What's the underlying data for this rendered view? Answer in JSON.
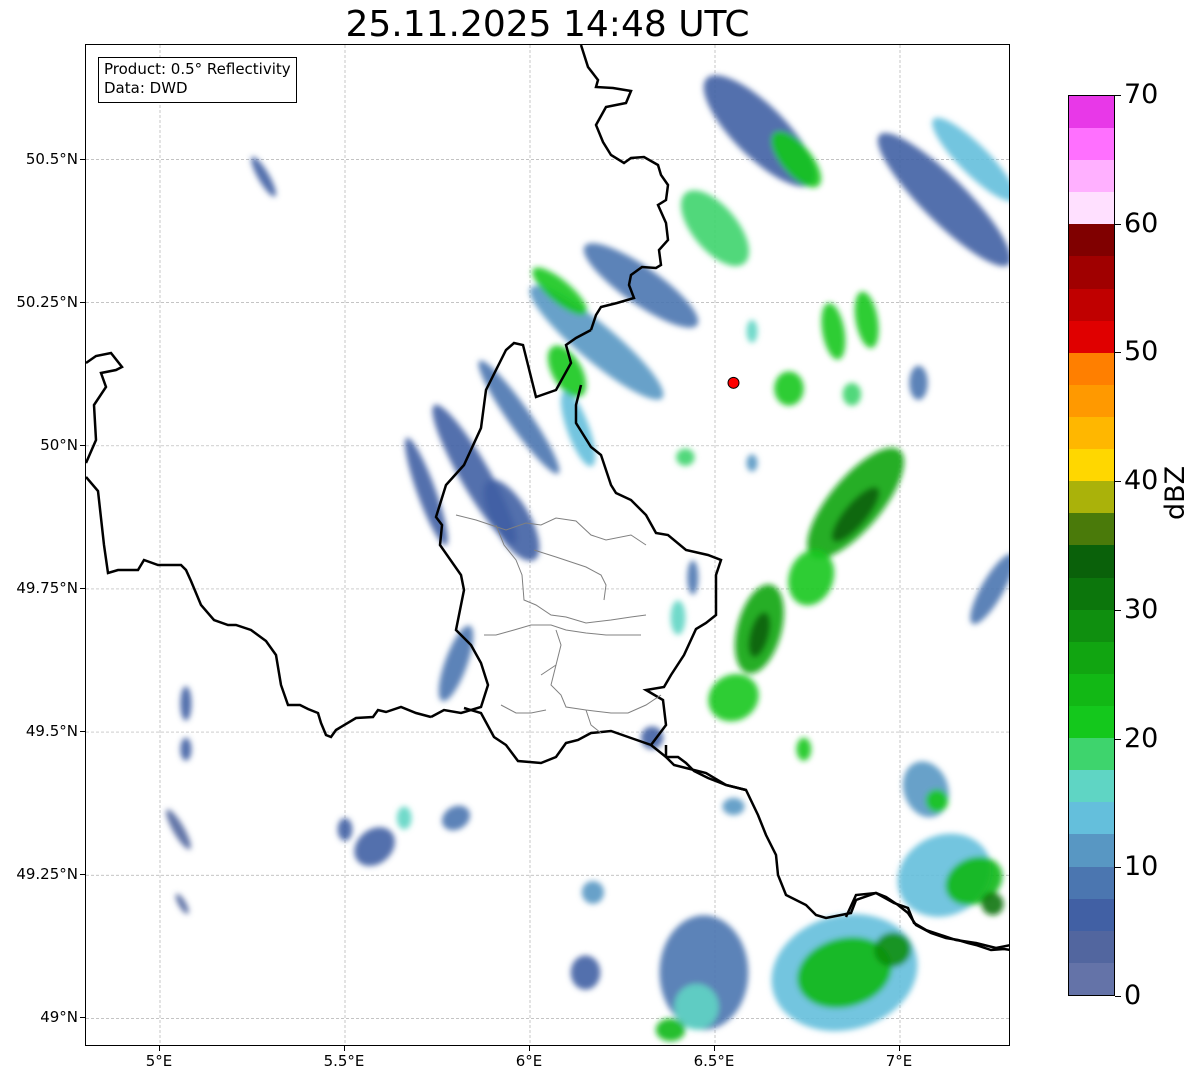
{
  "title": "25.11.2025 14:48 UTC",
  "info_box": {
    "product": "Product: 0.5° Reflectivity",
    "data": "Data: DWD"
  },
  "map": {
    "extent": {
      "lon_min": 4.8,
      "lon_max": 7.3,
      "lat_min": 48.95,
      "lat_max": 50.7
    },
    "lat_ticks": [
      {
        "value": 50.5,
        "label": "50.5°N"
      },
      {
        "value": 50.25,
        "label": "50.25°N"
      },
      {
        "value": 50.0,
        "label": "50°N"
      },
      {
        "value": 49.75,
        "label": "49.75°N"
      },
      {
        "value": 49.5,
        "label": "49.5°N"
      },
      {
        "value": 49.25,
        "label": "49.25°N"
      },
      {
        "value": 49.0,
        "label": "49°N"
      }
    ],
    "lon_ticks": [
      {
        "value": 5.0,
        "label": "5°E"
      },
      {
        "value": 5.5,
        "label": "5.5°E"
      },
      {
        "value": 6.0,
        "label": "6°E"
      },
      {
        "value": 6.5,
        "label": "6.5°E"
      },
      {
        "value": 7.0,
        "label": "7°E"
      }
    ],
    "radar_site": {
      "lon": 6.55,
      "lat": 50.11,
      "color": "#ff0000"
    },
    "border_color": "#000000",
    "admin_border_color": "#808080",
    "grid": true
  },
  "colorbar": {
    "label": "dBZ",
    "min": 0,
    "max": 70,
    "step": 2.5,
    "ticks": [
      {
        "value": 0,
        "label": "0"
      },
      {
        "value": 10,
        "label": "10"
      },
      {
        "value": 20,
        "label": "20"
      },
      {
        "value": 30,
        "label": "30"
      },
      {
        "value": 40,
        "label": "40"
      },
      {
        "value": 50,
        "label": "50"
      },
      {
        "value": 60,
        "label": "60"
      },
      {
        "value": 70,
        "label": "70"
      }
    ],
    "colors": [
      "#6473a8",
      "#52669f",
      "#4160a4",
      "#4b76b0",
      "#5897c3",
      "#64bfdc",
      "#5fd5c4",
      "#3ed46d",
      "#14c81c",
      "#12b815",
      "#11a511",
      "#0f8f0f",
      "#0c760c",
      "#0a610a",
      "#4a7a0a",
      "#aab20a",
      "#ffd700",
      "#ffb700",
      "#ff9900",
      "#ff7f00",
      "#e00000",
      "#c00000",
      "#a00000",
      "#800000",
      "#ffe0ff",
      "#ffb0ff",
      "#ff70ff",
      "#e838e8"
    ]
  },
  "echoes": [
    {
      "lon": 6.62,
      "lat": 50.55,
      "rx": 0.07,
      "ry": 0.13,
      "rot": -45,
      "dbz": 6
    },
    {
      "lon": 6.5,
      "lat": 50.38,
      "rx": 0.06,
      "ry": 0.08,
      "rot": -40,
      "dbz": 18
    },
    {
      "lon": 6.72,
      "lat": 50.5,
      "rx": 0.04,
      "ry": 0.06,
      "rot": -40,
      "dbz": 22
    },
    {
      "lon": 6.3,
      "lat": 50.28,
      "rx": 0.05,
      "ry": 0.12,
      "rot": -55,
      "dbz": 8
    },
    {
      "lon": 6.18,
      "lat": 50.18,
      "rx": 0.05,
      "ry": 0.15,
      "rot": -50,
      "dbz": 10
    },
    {
      "lon": 6.08,
      "lat": 50.27,
      "rx": 0.03,
      "ry": 0.06,
      "rot": -50,
      "dbz": 20
    },
    {
      "lon": 5.97,
      "lat": 50.05,
      "rx": 0.03,
      "ry": 0.12,
      "rot": -35,
      "dbz": 8
    },
    {
      "lon": 5.85,
      "lat": 49.95,
      "rx": 0.04,
      "ry": 0.14,
      "rot": -30,
      "dbz": 6
    },
    {
      "lon": 5.72,
      "lat": 49.92,
      "rx": 0.025,
      "ry": 0.1,
      "rot": -20,
      "dbz": 5
    },
    {
      "lon": 5.95,
      "lat": 49.87,
      "rx": 0.05,
      "ry": 0.08,
      "rot": -30,
      "dbz": 5
    },
    {
      "lon": 6.13,
      "lat": 50.03,
      "rx": 0.03,
      "ry": 0.07,
      "rot": -20,
      "dbz": 14
    },
    {
      "lon": 6.1,
      "lat": 50.13,
      "rx": 0.04,
      "ry": 0.05,
      "rot": -30,
      "dbz": 20
    },
    {
      "lon": 5.28,
      "lat": 50.47,
      "rx": 0.015,
      "ry": 0.04,
      "rot": -30,
      "dbz": 5
    },
    {
      "lon": 7.12,
      "lat": 50.43,
      "rx": 0.06,
      "ry": 0.16,
      "rot": -45,
      "dbz": 7
    },
    {
      "lon": 7.2,
      "lat": 50.5,
      "rx": 0.04,
      "ry": 0.1,
      "rot": -45,
      "dbz": 14
    },
    {
      "lon": 6.82,
      "lat": 50.2,
      "rx": 0.03,
      "ry": 0.05,
      "rot": -10,
      "dbz": 22
    },
    {
      "lon": 6.91,
      "lat": 50.22,
      "rx": 0.03,
      "ry": 0.05,
      "rot": -10,
      "dbz": 20
    },
    {
      "lon": 6.7,
      "lat": 50.1,
      "rx": 0.04,
      "ry": 0.03,
      "rot": 0,
      "dbz": 20
    },
    {
      "lon": 6.87,
      "lat": 50.09,
      "rx": 0.025,
      "ry": 0.02,
      "rot": 0,
      "dbz": 18
    },
    {
      "lon": 6.6,
      "lat": 50.2,
      "rx": 0.015,
      "ry": 0.02,
      "rot": 0,
      "dbz": 15
    },
    {
      "lon": 7.05,
      "lat": 50.11,
      "rx": 0.025,
      "ry": 0.03,
      "rot": 0,
      "dbz": 8
    },
    {
      "lon": 6.42,
      "lat": 49.98,
      "rx": 0.025,
      "ry": 0.015,
      "rot": 0,
      "dbz": 18
    },
    {
      "lon": 6.6,
      "lat": 49.97,
      "rx": 0.015,
      "ry": 0.015,
      "rot": 0,
      "dbz": 10
    },
    {
      "lon": 6.88,
      "lat": 49.9,
      "rx": 0.07,
      "ry": 0.12,
      "rot": 40,
      "dbz": 26
    },
    {
      "lon": 6.88,
      "lat": 49.88,
      "rx": 0.03,
      "ry": 0.06,
      "rot": 40,
      "dbz": 34
    },
    {
      "lon": 6.76,
      "lat": 49.77,
      "rx": 0.06,
      "ry": 0.05,
      "rot": 20,
      "dbz": 22
    },
    {
      "lon": 6.62,
      "lat": 49.68,
      "rx": 0.06,
      "ry": 0.08,
      "rot": 15,
      "dbz": 26
    },
    {
      "lon": 6.62,
      "lat": 49.67,
      "rx": 0.025,
      "ry": 0.04,
      "rot": 15,
      "dbz": 34
    },
    {
      "lon": 6.55,
      "lat": 49.56,
      "rx": 0.07,
      "ry": 0.04,
      "rot": -30,
      "dbz": 22
    },
    {
      "lon": 6.4,
      "lat": 49.7,
      "rx": 0.02,
      "ry": 0.03,
      "rot": 0,
      "dbz": 16
    },
    {
      "lon": 6.44,
      "lat": 49.77,
      "rx": 0.015,
      "ry": 0.03,
      "rot": 0,
      "dbz": 8
    },
    {
      "lon": 6.74,
      "lat": 49.47,
      "rx": 0.02,
      "ry": 0.02,
      "rot": 0,
      "dbz": 22
    },
    {
      "lon": 7.25,
      "lat": 49.75,
      "rx": 0.03,
      "ry": 0.07,
      "rot": 30,
      "dbz": 8
    },
    {
      "lon": 6.33,
      "lat": 49.49,
      "rx": 0.03,
      "ry": 0.02,
      "rot": 0,
      "dbz": 6
    },
    {
      "lon": 5.8,
      "lat": 49.62,
      "rx": 0.03,
      "ry": 0.07,
      "rot": 20,
      "dbz": 8
    },
    {
      "lon": 5.07,
      "lat": 49.55,
      "rx": 0.015,
      "ry": 0.03,
      "rot": 0,
      "dbz": 5
    },
    {
      "lon": 5.07,
      "lat": 49.47,
      "rx": 0.015,
      "ry": 0.02,
      "rot": 0,
      "dbz": 5
    },
    {
      "lon": 5.05,
      "lat": 49.33,
      "rx": 0.015,
      "ry": 0.04,
      "rot": -30,
      "dbz": 4
    },
    {
      "lon": 5.06,
      "lat": 49.2,
      "rx": 0.01,
      "ry": 0.02,
      "rot": -30,
      "dbz": 4
    },
    {
      "lon": 5.58,
      "lat": 49.3,
      "rx": 0.06,
      "ry": 0.03,
      "rot": -40,
      "dbz": 5
    },
    {
      "lon": 5.8,
      "lat": 49.35,
      "rx": 0.04,
      "ry": 0.02,
      "rot": -30,
      "dbz": 8
    },
    {
      "lon": 5.66,
      "lat": 49.35,
      "rx": 0.02,
      "ry": 0.02,
      "rot": 0,
      "dbz": 16
    },
    {
      "lon": 6.17,
      "lat": 49.22,
      "rx": 0.03,
      "ry": 0.02,
      "rot": 0,
      "dbz": 12
    },
    {
      "lon": 6.15,
      "lat": 49.08,
      "rx": 0.04,
      "ry": 0.03,
      "rot": 0,
      "dbz": 6
    },
    {
      "lon": 6.47,
      "lat": 49.08,
      "rx": 0.12,
      "ry": 0.1,
      "rot": 0,
      "dbz": 8
    },
    {
      "lon": 6.45,
      "lat": 49.02,
      "rx": 0.06,
      "ry": 0.04,
      "rot": 0,
      "dbz": 16
    },
    {
      "lon": 6.38,
      "lat": 48.98,
      "rx": 0.04,
      "ry": 0.02,
      "rot": 0,
      "dbz": 24
    },
    {
      "lon": 6.85,
      "lat": 49.08,
      "rx": 0.2,
      "ry": 0.1,
      "rot": -15,
      "dbz": 14
    },
    {
      "lon": 6.85,
      "lat": 49.08,
      "rx": 0.13,
      "ry": 0.06,
      "rot": -15,
      "dbz": 24
    },
    {
      "lon": 6.98,
      "lat": 49.12,
      "rx": 0.05,
      "ry": 0.03,
      "rot": -15,
      "dbz": 28
    },
    {
      "lon": 7.12,
      "lat": 49.25,
      "rx": 0.13,
      "ry": 0.07,
      "rot": -25,
      "dbz": 14
    },
    {
      "lon": 7.2,
      "lat": 49.24,
      "rx": 0.08,
      "ry": 0.04,
      "rot": -25,
      "dbz": 24
    },
    {
      "lon": 7.25,
      "lat": 49.2,
      "rx": 0.03,
      "ry": 0.02,
      "rot": -25,
      "dbz": 30
    },
    {
      "lon": 7.07,
      "lat": 49.4,
      "rx": 0.06,
      "ry": 0.05,
      "rot": -20,
      "dbz": 12
    },
    {
      "lon": 7.1,
      "lat": 49.38,
      "rx": 0.03,
      "ry": 0.02,
      "rot": -20,
      "dbz": 22
    },
    {
      "lon": 6.55,
      "lat": 49.37,
      "rx": 0.03,
      "ry": 0.015,
      "rot": 0,
      "dbz": 10
    },
    {
      "lon": 5.5,
      "lat": 49.33,
      "rx": 0.02,
      "ry": 0.02,
      "rot": 0,
      "dbz": 6
    }
  ]
}
